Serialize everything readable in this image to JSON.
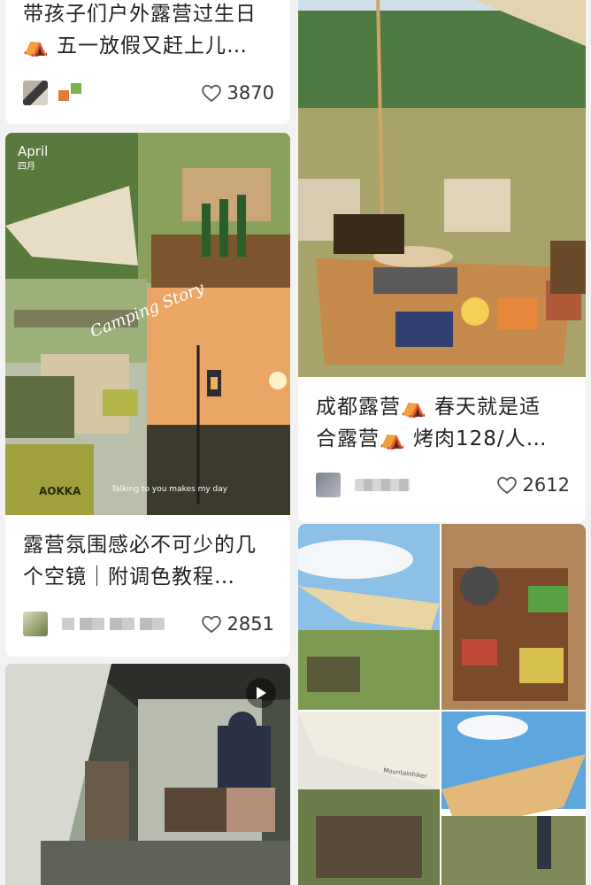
{
  "feed": {
    "cards": [
      {
        "title_l1": "带孩子们户外露营过生日",
        "title_l2": "五一放假又赶上儿…",
        "likes": "3870"
      },
      {
        "photo_caption_top": "April",
        "photo_caption_sub": "四月",
        "photo_script": "Camping Story",
        "photo_footer": "Talking to you makes my day",
        "brand": "AOKKA"
      },
      {
        "title_l1": "成都露营⛺ 春天就是适",
        "title_l2": "合露营⛺ 烤肉128/人…",
        "likes": "2612"
      },
      {
        "title_l1": "露营氛围感必不可少的几",
        "title_l2": "个空镜｜附调色教程…",
        "likes": "2851"
      },
      {
        "tent_brand": "Mountainhiker"
      }
    ]
  },
  "icons": {
    "heart": "heart-outline-icon",
    "tent": "tent-emoji-icon",
    "play": "play-icon"
  },
  "colors": {
    "background": "#f2f2f2",
    "card": "#ffffff",
    "text": "#222222",
    "like_text": "#333333"
  }
}
